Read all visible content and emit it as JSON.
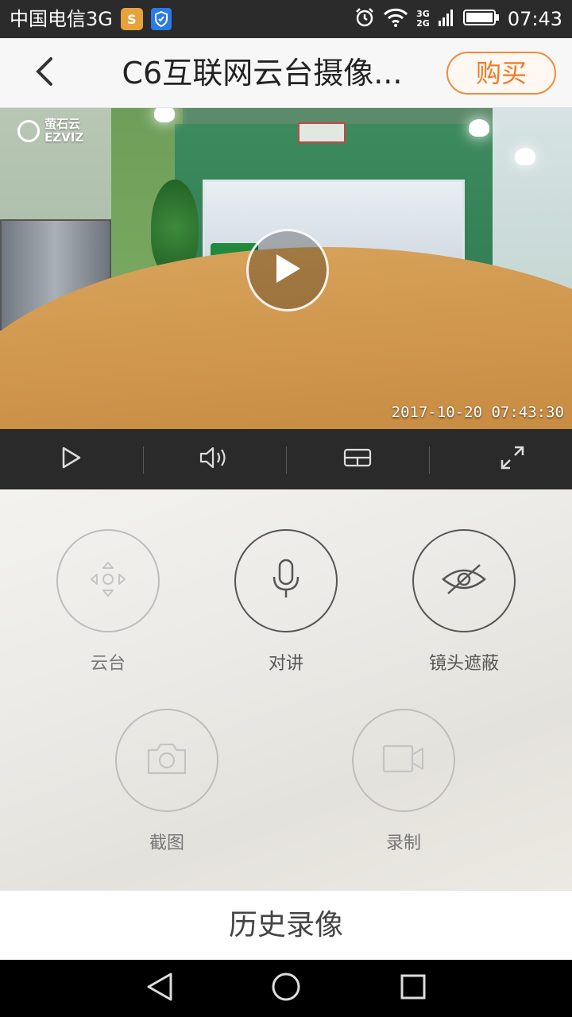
{
  "status_bar": {
    "carrier": "中国电信3G",
    "app_icon": "S",
    "network_top": "3G",
    "network_bottom": "2G",
    "time": "07:43",
    "icons": [
      "alarm-icon",
      "wifi-icon",
      "signal-icon",
      "battery-icon"
    ]
  },
  "header": {
    "back_icon": "chevron-left-icon",
    "title": "C6互联网云台摄像...",
    "buy_label": "购买"
  },
  "video": {
    "logo_text_cn": "萤石云",
    "logo_text_en": "EZVIZ",
    "timestamp": "2017-10-20 07:43:30",
    "play_icon": "play-icon"
  },
  "controls": [
    {
      "name": "play",
      "icon": "play-outline-icon"
    },
    {
      "name": "volume",
      "icon": "speaker-icon"
    },
    {
      "name": "quality",
      "icon": "grid-icon"
    },
    {
      "name": "fullscreen",
      "icon": "expand-icon"
    }
  ],
  "features": {
    "ptz": {
      "label": "云台",
      "icon": "ptz-icon",
      "enabled": false
    },
    "talk": {
      "label": "对讲",
      "icon": "microphone-icon",
      "enabled": true
    },
    "privacy": {
      "label": "镜头遮蔽",
      "icon": "eye-off-icon",
      "enabled": true
    },
    "capture": {
      "label": "截图",
      "icon": "camera-icon",
      "enabled": false
    },
    "record": {
      "label": "录制",
      "icon": "video-camera-icon",
      "enabled": false
    }
  },
  "history_label": "历史录像",
  "nav": [
    "back-triangle-icon",
    "home-circle-icon",
    "recents-square-icon"
  ],
  "colors": {
    "accent": "#f07a26",
    "active_icon": "#555555",
    "inactive_icon": "#bdbdbd",
    "control_bar": "#2a2a2a"
  }
}
